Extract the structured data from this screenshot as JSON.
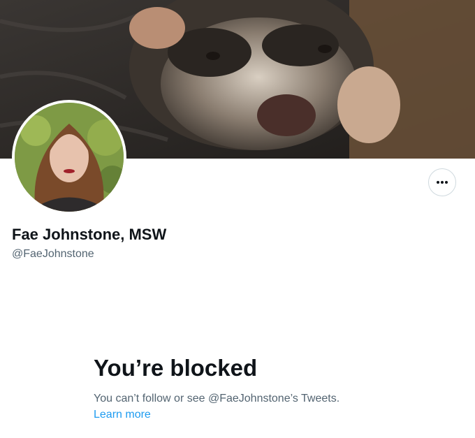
{
  "profile": {
    "display_name": "Fae Johnstone, MSW",
    "handle": "@FaeJohnstone"
  },
  "header": {
    "banner_subject": "ferret-photo",
    "more_icon": "ellipsis-icon"
  },
  "blocked_notice": {
    "title": "You’re blocked",
    "message": "You can’t follow or see @FaeJohnstone’s Tweets.",
    "link_label": "Learn more"
  },
  "colors": {
    "text_primary": "#0f1419",
    "text_secondary": "#536471",
    "link": "#1d9bf0",
    "border": "#cfd9de"
  }
}
